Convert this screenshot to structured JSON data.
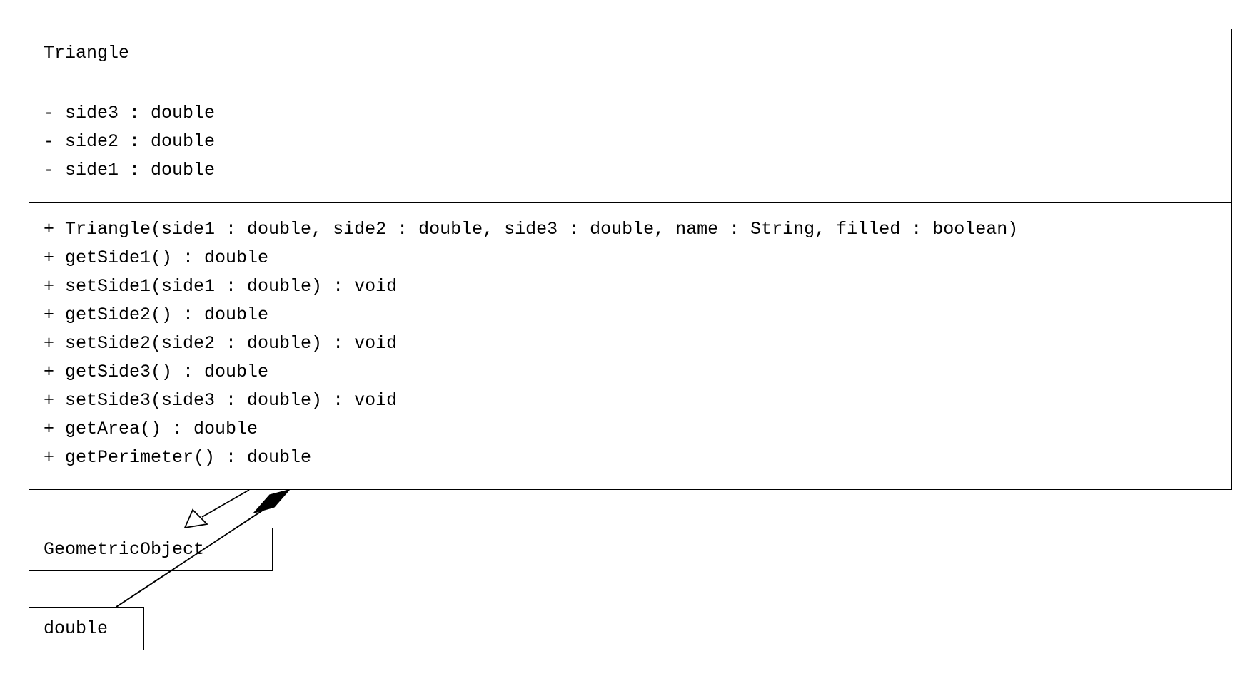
{
  "classes": {
    "triangle": {
      "name": "Triangle",
      "attributes": [
        "- side3 : double",
        "- side2 : double",
        "- side1 : double"
      ],
      "operations": [
        "+ Triangle(side1 : double, side2 : double, side3 : double, name : String, filled : boolean)",
        "+ getSide1() : double",
        "+ setSide1(side1 : double) : void",
        "+ getSide2() : double",
        "+ setSide2(side2 : double) : void",
        "+ getSide3() : double",
        "+ setSide3(side3 : double) : void",
        "+ getArea() : double",
        "+ getPerimeter() : double"
      ]
    },
    "geometric_object": {
      "name": "GeometricObject"
    },
    "double": {
      "name": "double"
    }
  },
  "relationships": [
    {
      "type": "generalization",
      "from": "Triangle",
      "to": "GeometricObject"
    },
    {
      "type": "composition",
      "from": "Triangle",
      "to": "double"
    }
  ],
  "colors": {
    "stroke": "#000000",
    "background": "#ffffff"
  }
}
